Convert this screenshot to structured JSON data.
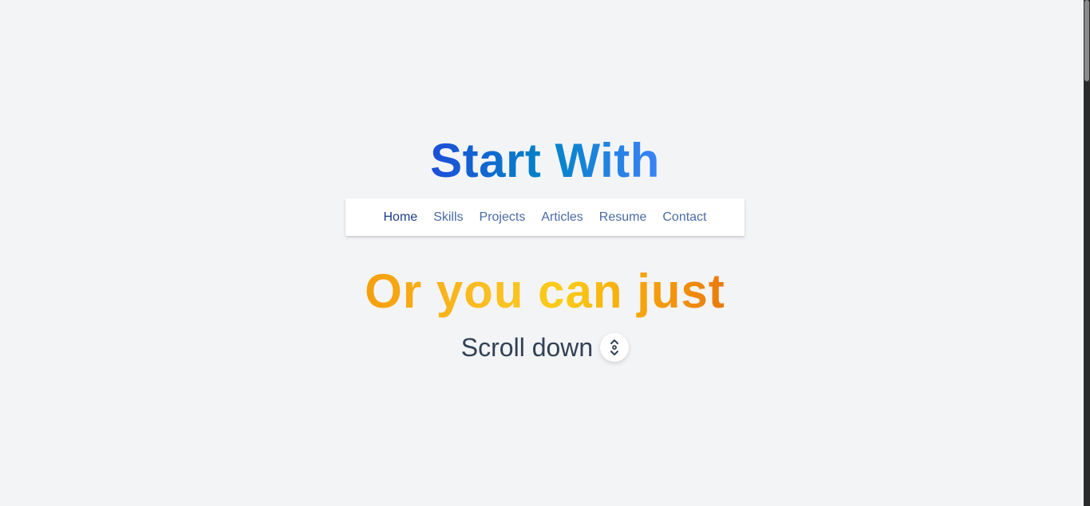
{
  "hero": {
    "title_top": "Start With",
    "title_mid": "Or you can just",
    "scroll_text": "Scroll down",
    "scroll_icon": "scroll-down-icon"
  },
  "nav": {
    "items": [
      {
        "label": "Home",
        "active": true
      },
      {
        "label": "Skills",
        "active": false
      },
      {
        "label": "Projects",
        "active": false
      },
      {
        "label": "Articles",
        "active": false
      },
      {
        "label": "Resume",
        "active": false
      },
      {
        "label": "Contact",
        "active": false
      }
    ]
  },
  "colors": {
    "background": "#f3f4f6",
    "nav_link": "#4b6aa6",
    "nav_link_active": "#1e3a8a",
    "text_dark": "#334155",
    "gradient_blue": [
      "#1d4ed8",
      "#0284c7",
      "#3b82f6"
    ],
    "gradient_orange": [
      "#f59e0b",
      "#facc15",
      "#ea7a0c"
    ]
  }
}
